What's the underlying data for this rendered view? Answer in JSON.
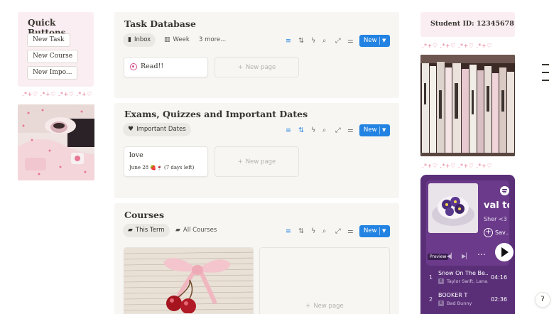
{
  "quick_buttons": {
    "title": "Quick Buttons",
    "buttons": [
      "New Task",
      "New Course",
      "New Impo..."
    ]
  },
  "decorations": {
    "hearts": ".*+♡ .*+♡ .*+♡ .*+♡"
  },
  "task_database": {
    "title": "Task Database",
    "tabs": [
      "Inbox",
      "Week",
      "3 more..."
    ],
    "new_label": "New",
    "cards": [
      {
        "title": "Read!!"
      }
    ],
    "new_page": "New page"
  },
  "exams": {
    "title": "Exams, Quizzes and Important Dates",
    "tabs": [
      "Important Dates"
    ],
    "new_label": "New",
    "cards": [
      {
        "title": "love",
        "date": "June 28 🍓🍷 (7 days left)"
      }
    ],
    "new_page": "New page"
  },
  "courses": {
    "title": "Courses",
    "tabs": [
      "This Term",
      "All Courses"
    ],
    "new_label": "New",
    "new_page": "New page"
  },
  "student": {
    "id_text": "Student ID: 12345678"
  },
  "spotify": {
    "title": "val to",
    "subtitle": "Sher <3",
    "save_label": "Sav...",
    "preview_label": "Preview",
    "tracks": [
      {
        "num": "1",
        "title": "Snow On The Be...",
        "artist": "Taylor Swift, Lana...",
        "time": "04:16"
      },
      {
        "num": "2",
        "title": "BOOKER T",
        "artist": "Bad Bunny",
        "time": "02:36"
      }
    ]
  },
  "colors": {
    "accent": "#2383e2",
    "pink_bg": "#fbeef2",
    "spotify_bg": "#5a2f78"
  }
}
